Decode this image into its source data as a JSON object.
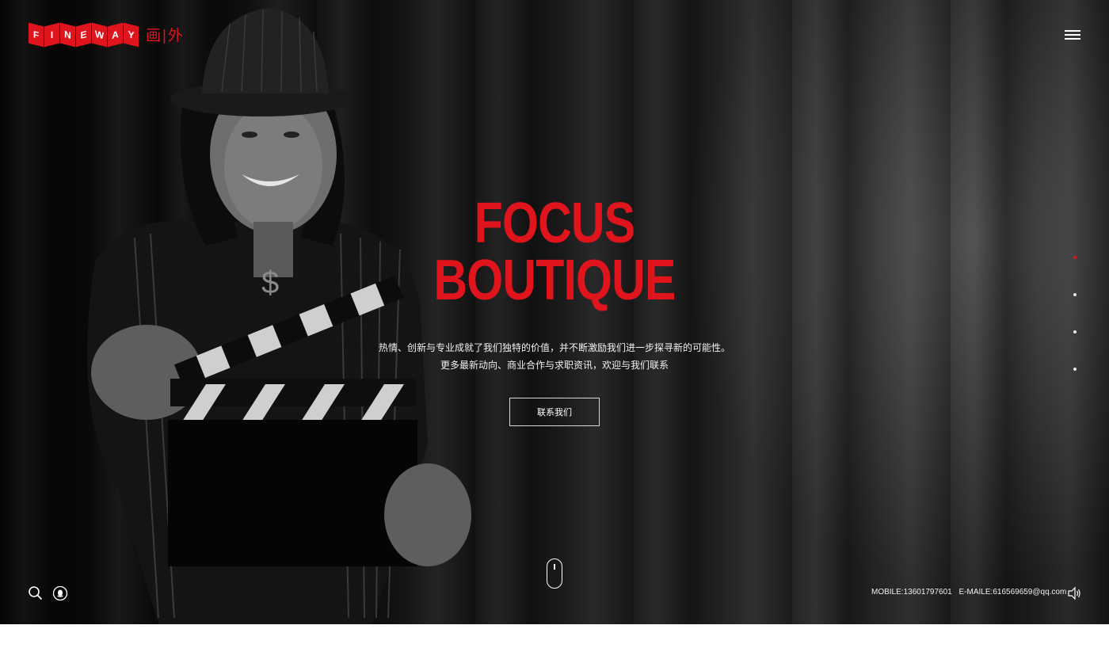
{
  "logo": {
    "letters": [
      "F",
      "I",
      "N",
      "E",
      "W",
      "A",
      "Y"
    ],
    "cn_text": "画|外"
  },
  "hero": {
    "headline_line1": "FOCUS",
    "headline_line2": "BOUTIQUE",
    "description_line1": "热情、创新与专业成就了我们独特的价值，并不断激励我们进一步探寻新的可能性。",
    "description_line2": "更多最新动向、商业合作与求职资讯，欢迎与我们联系",
    "cta_label": "联系我们"
  },
  "pagination": {
    "count": 4,
    "active_index": 0
  },
  "footer": {
    "mobile": "MOBILE:13601797601",
    "email": "E-MAILE:616569659@qq.com"
  },
  "icons": [
    "menu-icon",
    "search-icon",
    "qq-icon",
    "scroll-mouse-icon",
    "volume-icon"
  ],
  "colors": {
    "accent": "#e0141c",
    "text": "#ffffff"
  }
}
